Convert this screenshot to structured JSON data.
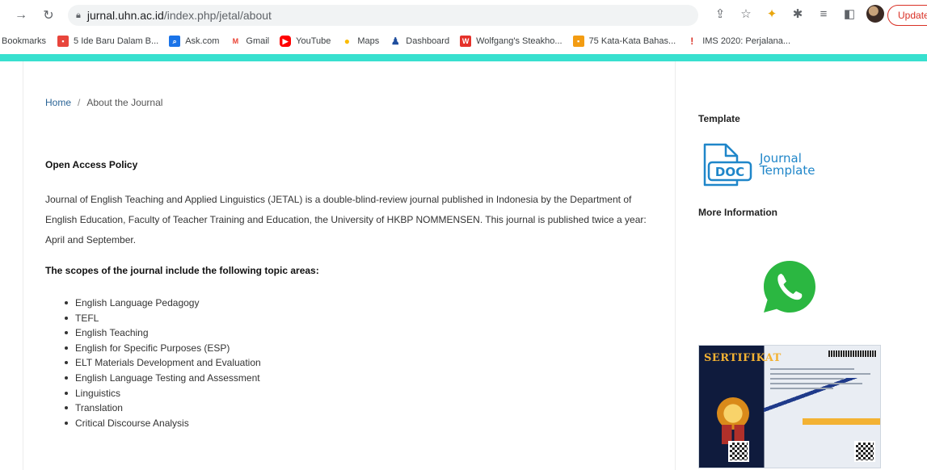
{
  "browser": {
    "url_host": "jurnal.uhn.ac.id",
    "url_path": "/index.php/jetal/about",
    "update_label": "Update"
  },
  "bookmarks": {
    "label": "Bookmarks",
    "items": [
      {
        "label": "5 Ide Baru Dalam B...",
        "icon": "news-icon",
        "color": "#e8453c"
      },
      {
        "label": "Ask.com",
        "icon": "search-icon",
        "color": "#1a73e8"
      },
      {
        "label": "Gmail",
        "icon": "gmail-icon",
        "color": "#ea4335"
      },
      {
        "label": "YouTube",
        "icon": "youtube-icon",
        "color": "#ff0000"
      },
      {
        "label": "Maps",
        "icon": "maps-pin-icon",
        "color": "#fbbc04"
      },
      {
        "label": "Dashboard",
        "icon": "dashboard-icon",
        "color": "#1f4e9e"
      },
      {
        "label": "Wolfgang's Steakho...",
        "icon": "restaurant-icon",
        "color": "#e5312a"
      },
      {
        "label": "75 Kata-Kata Bahas...",
        "icon": "article-icon",
        "color": "#f39c12"
      },
      {
        "label": "IMS 2020: Perjalana...",
        "icon": "ims-icon",
        "color": "#d93025"
      }
    ]
  },
  "breadcrumb": {
    "home": "Home",
    "separator": "/",
    "current": "About the Journal"
  },
  "main": {
    "open_access_title": "Open Access Policy",
    "paragraph": "Journal of English Teaching and Applied Linguistics (JETAL) is a double-blind-review journal published in Indonesia by the Department of English Education, Faculty of Teacher Training and Education, the University of HKBP NOMMENSEN. This journal is published twice a year: April and September.",
    "scopes_title": "The scopes of the journal include the following topic areas:",
    "scopes": [
      "English Language Pedagogy",
      "TEFL",
      "English Teaching",
      "English for Specific Purposes (ESP)",
      "ELT Materials Development and Evaluation",
      "English Language Testing and Assessment",
      "Linguistics",
      "Translation",
      "Critical Discourse Analysis"
    ]
  },
  "sidebar": {
    "template_title": "Template",
    "template_icon_text": "DOC",
    "template_label_line1": "Journal",
    "template_label_line2": "Template",
    "more_info_title": "More Information",
    "certificate_title": "SERTIFIKAT"
  },
  "colors": {
    "accent_teal": "#38e0cf",
    "link": "#2a6496",
    "doc_blue": "#1f86c9",
    "whatsapp_green": "#2bb741"
  }
}
